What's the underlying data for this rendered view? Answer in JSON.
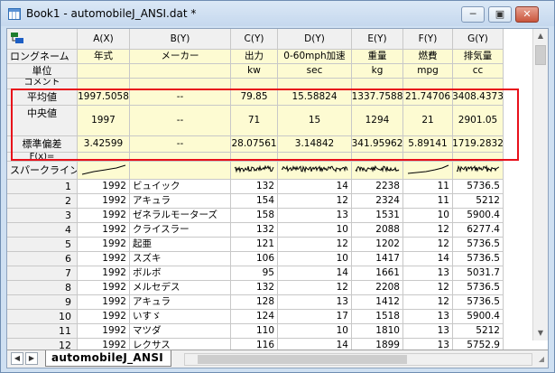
{
  "window": {
    "title": "Book1 - automobileJ_ANSI.dat *",
    "minimize": "─",
    "restore": "▣",
    "close": "✕"
  },
  "columns": [
    "A(X)",
    "B(Y)",
    "C(Y)",
    "D(Y)",
    "E(Y)",
    "F(Y)",
    "G(Y)"
  ],
  "meta_rows": [
    {
      "label": "ロングネーム",
      "values": [
        "年式",
        "メーカー",
        "出力",
        "0-60mph加速",
        "重量",
        "燃費",
        "排気量"
      ]
    },
    {
      "label": "単位",
      "values": [
        "",
        "",
        "kw",
        "sec",
        "kg",
        "mpg",
        "cc"
      ]
    },
    {
      "label": "コメント",
      "values": [
        "",
        "",
        "",
        "",
        "",
        "",
        ""
      ]
    }
  ],
  "stat_rows": [
    {
      "label": "平均値",
      "values": [
        "1997.5058",
        "--",
        "79.85",
        "15.58824",
        "1337.7588",
        "21.74706",
        "3408.4373"
      ]
    },
    {
      "label": "中央値",
      "values": [
        "1997",
        "--",
        "71",
        "15",
        "1294",
        "21",
        "2901.05"
      ]
    },
    {
      "label": "標準偏差",
      "values": [
        "3.42599",
        "--",
        "28.07561",
        "3.14842",
        "341.95962",
        "5.89141",
        "1719.2832"
      ]
    }
  ],
  "fx_row_label": "F(x)=",
  "sparkline_label": "スパークライン",
  "data_rows": [
    {
      "n": "1",
      "year": "1992",
      "maker": "ビュイック",
      "c": "132",
      "d": "14",
      "e": "2238",
      "f": "11",
      "g": "5736.5"
    },
    {
      "n": "2",
      "year": "1992",
      "maker": "アキュラ",
      "c": "154",
      "d": "12",
      "e": "2324",
      "f": "11",
      "g": "5212"
    },
    {
      "n": "3",
      "year": "1992",
      "maker": "ゼネラルモーターズ",
      "c": "158",
      "d": "13",
      "e": "1531",
      "f": "10",
      "g": "5900.4"
    },
    {
      "n": "4",
      "year": "1992",
      "maker": "クライスラー",
      "c": "132",
      "d": "10",
      "e": "2088",
      "f": "12",
      "g": "6277.4"
    },
    {
      "n": "5",
      "year": "1992",
      "maker": "起亜",
      "c": "121",
      "d": "12",
      "e": "1202",
      "f": "12",
      "g": "5736.5"
    },
    {
      "n": "6",
      "year": "1992",
      "maker": "スズキ",
      "c": "106",
      "d": "10",
      "e": "1417",
      "f": "14",
      "g": "5736.5"
    },
    {
      "n": "7",
      "year": "1992",
      "maker": "ボルボ",
      "c": "95",
      "d": "14",
      "e": "1661",
      "f": "13",
      "g": "5031.7"
    },
    {
      "n": "8",
      "year": "1992",
      "maker": "メルセデス",
      "c": "132",
      "d": "12",
      "e": "2208",
      "f": "12",
      "g": "5736.5"
    },
    {
      "n": "9",
      "year": "1992",
      "maker": "アキュラ",
      "c": "128",
      "d": "13",
      "e": "1412",
      "f": "12",
      "g": "5736.5"
    },
    {
      "n": "10",
      "year": "1992",
      "maker": "いすゞ",
      "c": "124",
      "d": "17",
      "e": "1518",
      "f": "13",
      "g": "5900.4"
    },
    {
      "n": "11",
      "year": "1992",
      "maker": "マツダ",
      "c": "110",
      "d": "10",
      "e": "1810",
      "f": "13",
      "g": "5212"
    },
    {
      "n": "12",
      "year": "1992",
      "maker": "レクサス",
      "c": "116",
      "d": "14",
      "e": "1899",
      "f": "13",
      "g": "5752.9"
    }
  ],
  "sheet_tab": "automobileJ_ANSI",
  "colors": {
    "meta_bg": "#fdfbd2",
    "highlight": "#e8101a",
    "header_bg": "#f0f0f0"
  }
}
